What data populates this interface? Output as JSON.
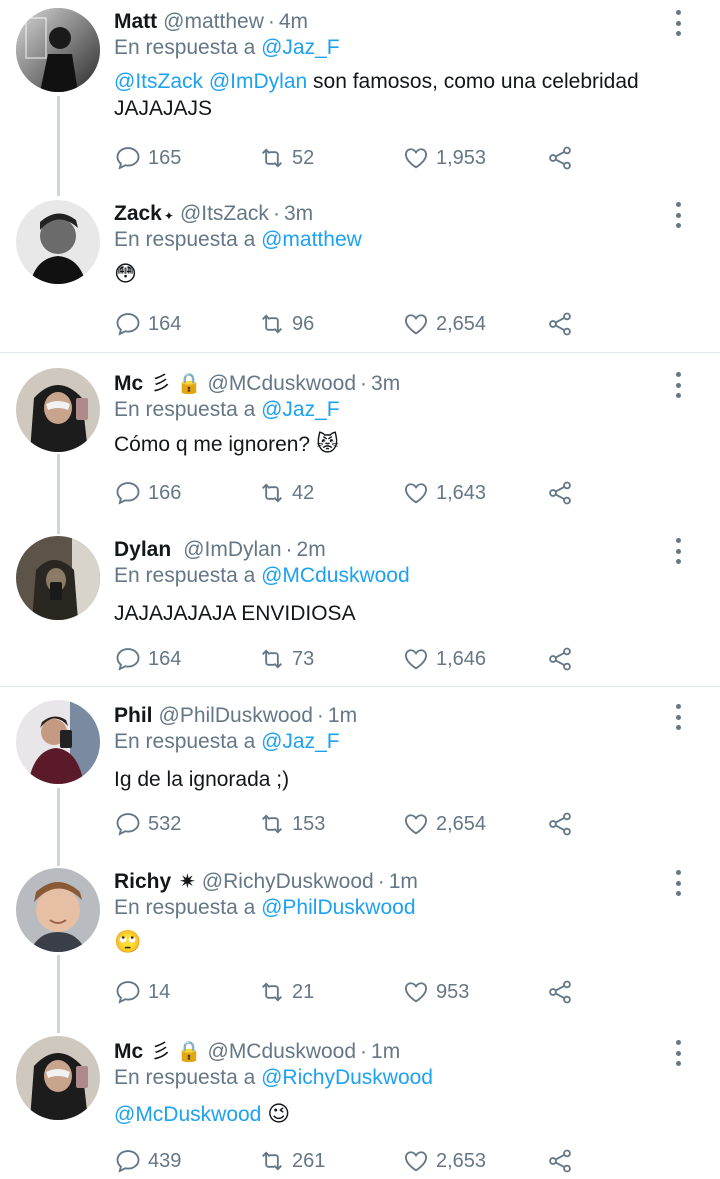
{
  "reply_prefix": "En respuesta a",
  "tweets": [
    {
      "name": "Matt",
      "badge": "",
      "handle": "@matthew",
      "sep": "·",
      "time": "4m",
      "reply_to": "@Jaz_F",
      "mention1": "@ItsZack",
      "mention2": "@ImDylan",
      "text": " son famosos, como una celebridad JAJAJAJS",
      "replies": "165",
      "retweets": "52",
      "likes": "1,953"
    },
    {
      "name": "Zack",
      "badge": "✦",
      "handle": "@ItsZack",
      "sep": "·",
      "time": "3m",
      "reply_to": "@matthew",
      "emoji": "😳",
      "replies": "164",
      "retweets": "96",
      "likes": "2,654"
    },
    {
      "name": "Mc",
      "badge": "彡 🔒",
      "handle": "@MCduskwood",
      "sep": "·",
      "time": "3m",
      "reply_to": "@Jaz_F",
      "text": "Cómo q me ignoren? ",
      "emoji": "😾",
      "replies": "166",
      "retweets": "42",
      "likes": "1,643"
    },
    {
      "name": "Dylan",
      "badge": "",
      "handle": "@ImDylan",
      "sep": "·",
      "time": "2m",
      "reply_to": "@MCduskwood",
      "text": "JAJAJAJAJA ENVIDIOSA",
      "replies": "164",
      "retweets": "73",
      "likes": "1,646"
    },
    {
      "name": "Phil",
      "badge": "",
      "handle": "@PhilDuskwood",
      "sep": "·",
      "time": "1m",
      "reply_to": "@Jaz_F",
      "text": "Ig de la ignorada ;)",
      "replies": "532",
      "retweets": "153",
      "likes": "2,654"
    },
    {
      "name": "Richy",
      "badge": "✷",
      "handle": "@RichyDuskwood",
      "sep": "·",
      "time": "1m",
      "reply_to": "@PhilDuskwood",
      "emoji": "🙄",
      "replies": "14",
      "retweets": "21",
      "likes": "953"
    },
    {
      "name": "Mc",
      "badge": "彡 🔒",
      "handle": "@MCduskwood",
      "sep": "·",
      "time": "1m",
      "reply_to": "@RichyDuskwood",
      "mention1": "@McDuskwood",
      "emoji": "😉",
      "replies": "439",
      "retweets": "261",
      "likes": "2,653"
    }
  ],
  "icons": {
    "reply": "reply-icon",
    "retweet": "retweet-icon",
    "like": "heart-icon",
    "share": "share-icon",
    "more": "more-icon"
  },
  "colors": {
    "accent": "#1da1f2",
    "muted": "#657786",
    "line": "#ccd6dd"
  }
}
